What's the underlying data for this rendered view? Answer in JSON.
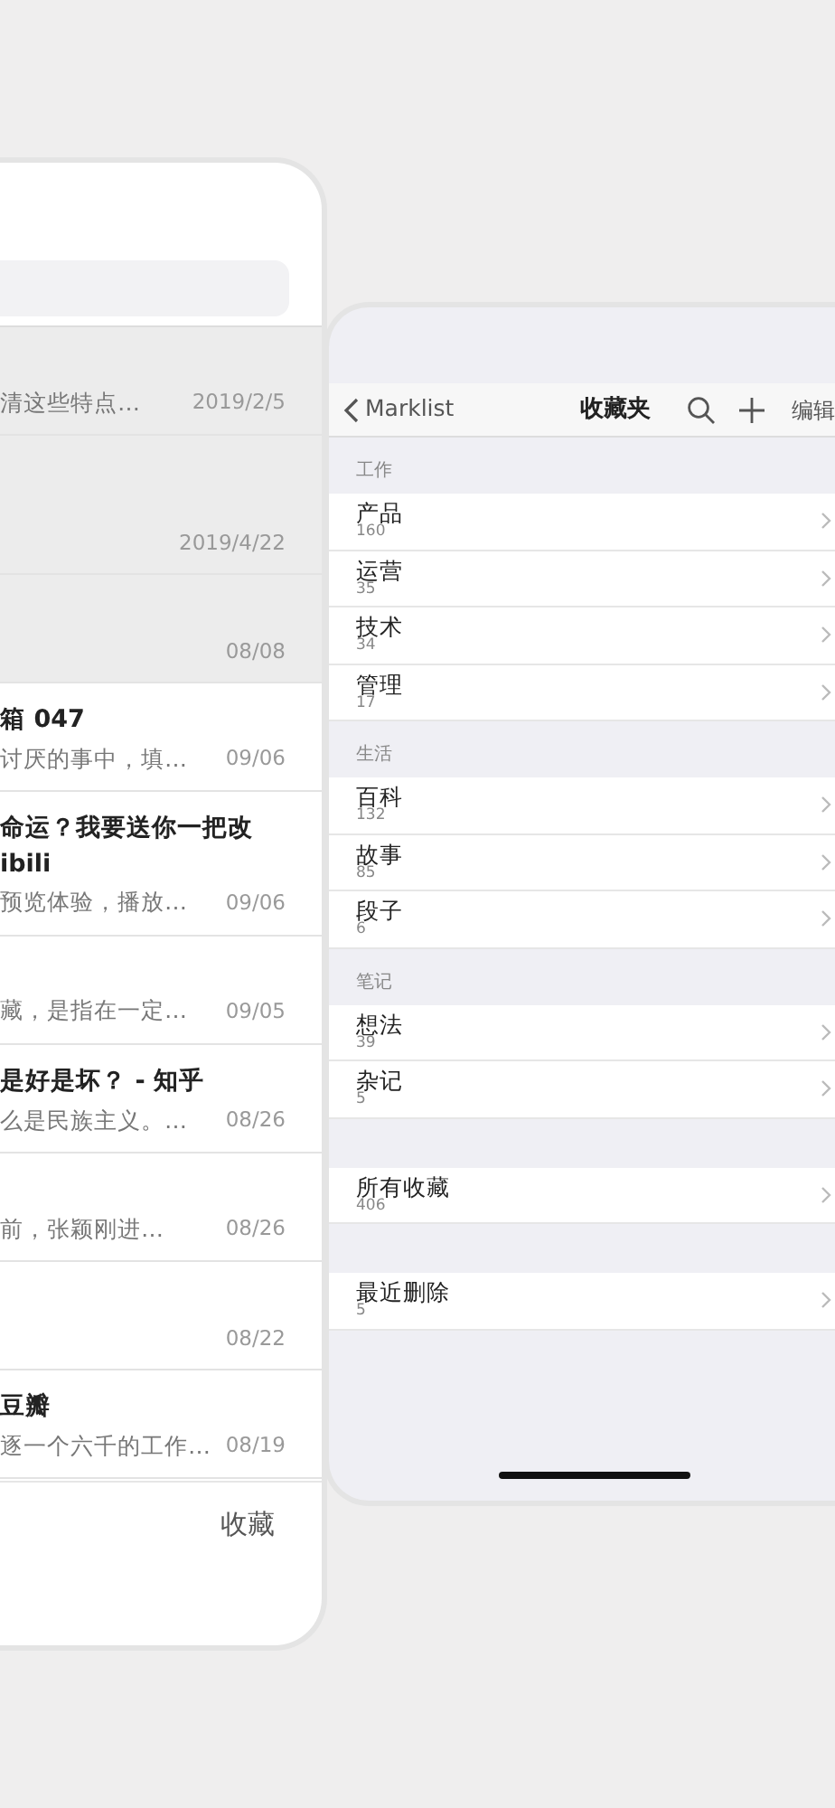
{
  "left_screen": {
    "articles": [
      {
        "summary": "清这些特点…",
        "date": "2019/2/5",
        "shaded": true,
        "tall": false
      },
      {
        "date": "2019/4/22",
        "shaded": true,
        "tall": true
      },
      {
        "date": "08/08",
        "shaded": true,
        "tall": false
      },
      {
        "title_lines": [
          "箱 047"
        ],
        "summary": "讨厌的事中，填…",
        "date": "09/06",
        "shaded": false,
        "tall": false
      },
      {
        "title_lines": [
          "命运？我要送你一把改",
          "ibili"
        ],
        "summary": "预览体验，播放…",
        "date": "09/06",
        "shaded": false,
        "tall": false
      },
      {
        "summary": "藏，是指在一定…",
        "date": "09/05",
        "shaded": false,
        "tall": false
      },
      {
        "title_lines": [
          "是好是坏？ - 知乎"
        ],
        "summary": "么是民族主义。…",
        "date": "08/26",
        "shaded": false,
        "tall": false
      },
      {
        "summary": "前，张颖刚进…",
        "date": "08/26",
        "shaded": false,
        "tall": false
      },
      {
        "date": "08/22",
        "shaded": false,
        "tall": false
      },
      {
        "title_lines": [
          "豆瓣"
        ],
        "summary": "逐一个六千的工作…",
        "date": "08/19",
        "shaded": false,
        "tall": false
      }
    ],
    "tab_label": "收藏"
  },
  "right_screen": {
    "nav": {
      "back_label": "Marklist",
      "title": "收藏夹",
      "edit_label": "编辑"
    },
    "groups": [
      {
        "header": "工作",
        "items": [
          {
            "name": "产品",
            "count": "160"
          },
          {
            "name": "运营",
            "count": "35"
          },
          {
            "name": "技术",
            "count": "34"
          },
          {
            "name": "管理",
            "count": "17"
          }
        ]
      },
      {
        "header": "生活",
        "items": [
          {
            "name": "百科",
            "count": "132"
          },
          {
            "name": "故事",
            "count": "85"
          },
          {
            "name": "段子",
            "count": "6"
          }
        ]
      },
      {
        "header": "笔记",
        "items": [
          {
            "name": "想法",
            "count": "39"
          },
          {
            "name": "杂记",
            "count": "5"
          }
        ]
      },
      {
        "items": [
          {
            "name": "所有收藏",
            "count": "406"
          }
        ]
      },
      {
        "items": [
          {
            "name": "最近删除",
            "count": "5"
          }
        ]
      }
    ]
  }
}
